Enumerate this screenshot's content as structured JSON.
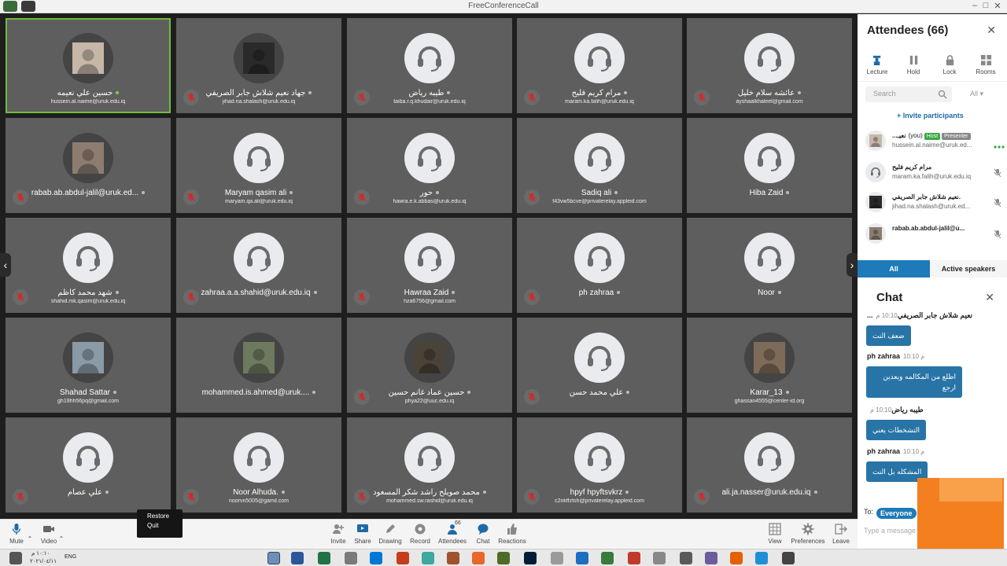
{
  "window": {
    "title": "FreeConferenceCall"
  },
  "tiles": [
    {
      "name": "حسين علي نعيمه",
      "email": "hussein.al.naime@uruk.edu.iq",
      "avatar": "photo",
      "active": true,
      "muted": false,
      "photo_color": "#c7b7a8"
    },
    {
      "name": "جهاد نعيم شلاش جابر الصريفي",
      "email": "jihad.na.shalash@uruk.edu.iq",
      "avatar": "photo",
      "muted": true,
      "photo_color": "#2a2a2a"
    },
    {
      "name": "طيبه رياض",
      "email": "taiba.r.q.khudair@uruk.edu.iq",
      "avatar": "headset",
      "muted": true
    },
    {
      "name": "مرام كريم فليح",
      "email": "maram.ka.falih@uruk.edu.iq",
      "avatar": "headset",
      "muted": true
    },
    {
      "name": "عائشه سلام خليل",
      "email": "ayshaalkhaleel@gmail.com",
      "avatar": "headset",
      "muted": true
    },
    {
      "name": "rabab.ab.abdul-jalil@uruk.ed...",
      "email": "",
      "avatar": "photo",
      "muted": true,
      "photo_color": "#8c7d70"
    },
    {
      "name": "Maryam qasim ali",
      "email": "maryam.qa.ali@uruk.edu.iq",
      "avatar": "headset",
      "muted": true
    },
    {
      "name": "حور",
      "email": "hawra.e.k.abbas@uruk.edu.iq",
      "avatar": "headset",
      "muted": true
    },
    {
      "name": "Sadiq ali",
      "email": "f43vw5bcve@privaterelay.appleid.com",
      "avatar": "headset",
      "muted": true
    },
    {
      "name": "Hiba Zaid",
      "email": "",
      "avatar": "headset",
      "muted": false
    },
    {
      "name": "شهد محمد كاظم",
      "email": "shahid.mk.qasim@uruk.edu.iq",
      "avatar": "headset",
      "muted": true
    },
    {
      "name": "zahraa.a.a.shahid@uruk.edu.iq",
      "email": "",
      "avatar": "headset",
      "muted": true
    },
    {
      "name": "Hawraa Zaid",
      "email": "hza6756@gmail.com",
      "avatar": "headset",
      "muted": true
    },
    {
      "name": "ph zahraa",
      "email": "",
      "avatar": "headset",
      "muted": true
    },
    {
      "name": "Noor",
      "email": "",
      "avatar": "headset",
      "muted": false
    },
    {
      "name": "Shahad Sattar",
      "email": "gh19hh56pq@gmail.com",
      "avatar": "photo",
      "muted": false,
      "photo_color": "#8a9aa6"
    },
    {
      "name": "mohammed.is.ahmed@uruk....",
      "email": "",
      "avatar": "photo",
      "muted": false,
      "photo_color": "#6d7a5e"
    },
    {
      "name": "حسين عماد غانم حسين",
      "email": "phya22@uuc.edu.iq",
      "avatar": "photo",
      "muted": true,
      "photo_color": "#4a4338"
    },
    {
      "name": "علي محمد حسن",
      "email": "",
      "avatar": "headset",
      "muted": true
    },
    {
      "name": "Karar_13",
      "email": "ghassan4555@center-id.org",
      "avatar": "photo",
      "muted": false,
      "photo_color": "#7e6a58"
    },
    {
      "name": "علي عصام",
      "email": "",
      "avatar": "headset",
      "muted": true
    },
    {
      "name": "Noor Alhuda.",
      "email": "noorvn5005@gamil.com",
      "avatar": "headset",
      "muted": true
    },
    {
      "name": "محمد صويلح راشد شكر المسعود",
      "email": "mohammed.sw.rashid@uruk.edu.iq",
      "avatar": "headset",
      "muted": true
    },
    {
      "name": "hpyf hpyftsvkrz",
      "email": "c2nkffztsh@privaterelay.appleid.com",
      "avatar": "headset",
      "muted": true
    },
    {
      "name": "ali.ja.nasser@uruk.edu.iq",
      "email": "",
      "avatar": "headset",
      "muted": true
    }
  ],
  "toolbar": {
    "mute": "Mute",
    "video": "Video",
    "invite": "Invite",
    "share": "Share",
    "drawing": "Drawing",
    "record": "Record",
    "attendees": "Attendees",
    "attendees_count": "66",
    "chat": "Chat",
    "reactions": "Reactions",
    "view": "View",
    "preferences": "Preferences",
    "leave": "Leave"
  },
  "popup": {
    "restore": "Restore",
    "quit": "Quit"
  },
  "panel": {
    "title": "Attendees (66)",
    "buttons": {
      "lecture": "Lecture",
      "hold": "Hold",
      "lock": "Lock",
      "rooms": "Rooms"
    },
    "search_placeholder": "Search",
    "filter": "All",
    "invite": "Invite participants",
    "attendees": [
      {
        "name": "...نعيـ",
        "you": "(you)",
        "host": "Host",
        "presenter": "Presenter",
        "email": "hussein.al.naime@uruk.ed...",
        "avatar": "photo",
        "photo_color": "#c7b7a8"
      },
      {
        "name": "مرام كريم فليح",
        "email": "maram.ka.falih@uruk.edu.iq",
        "avatar": "headset"
      },
      {
        "name": "نعيم شلاش جابر الصريفي.",
        "email": "jihad.na.shalash@uruk.ed...",
        "avatar": "photo",
        "photo_color": "#2a2a2a"
      },
      {
        "name": "rabab.ab.abdul-jalil@u...",
        "email": "",
        "avatar": "photo",
        "photo_color": "#8c7d70"
      }
    ],
    "tab_all": "All",
    "tab_active": "Active speakers"
  },
  "chat": {
    "title": "Chat",
    "messages": [
      {
        "sender": "...نعيم شلاش جابر الصريفي",
        "time": "10:10 م",
        "text": "ضعف النت"
      },
      {
        "sender": "ph zahraa",
        "time": "10:10 م",
        "text": "اطلع من المكالمه وبعدين ارجع"
      },
      {
        "sender": "طيبه رياض",
        "time": "10:10 م",
        "text": "التشخطات يعني"
      },
      {
        "sender": "ph zahraa",
        "time": "10:10 م",
        "text": "المشكله بل النت"
      }
    ],
    "to_label": "To:",
    "to_value": "Everyone",
    "input_placeholder": "Type a message"
  },
  "taskbar": {
    "time": "١٠:١٠ م",
    "date": "٢٠٢١/٠٤/١١",
    "lang": "ENG"
  },
  "colors": {
    "accent": "#2874a6",
    "active_border": "#6dbe3b",
    "orange": "#f47f1f"
  }
}
